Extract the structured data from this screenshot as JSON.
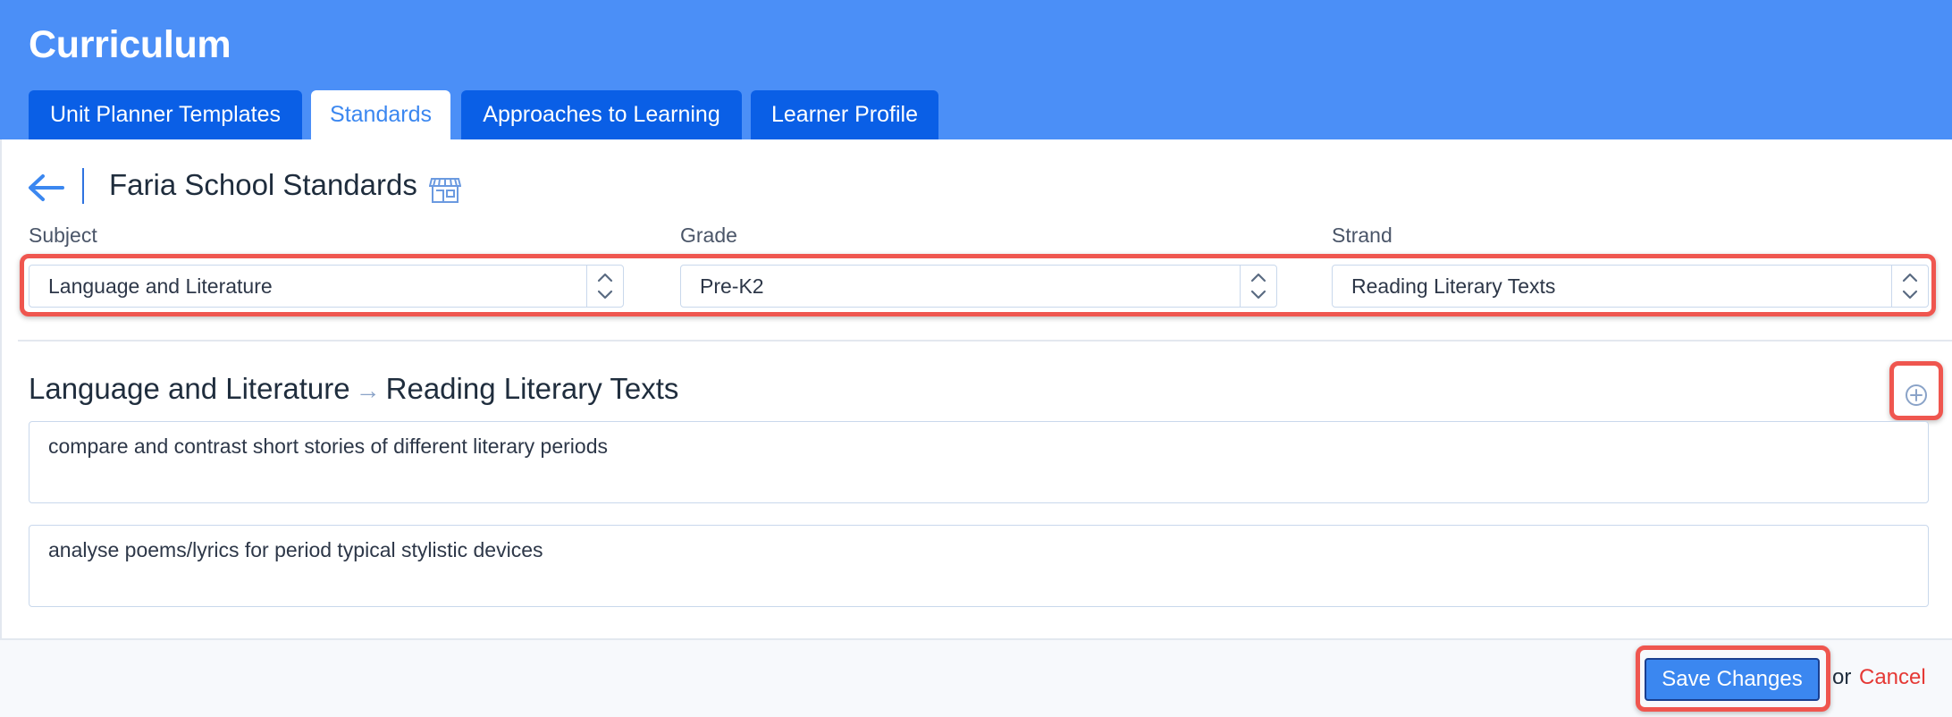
{
  "app": {
    "title": "Curriculum"
  },
  "tabs": [
    {
      "label": "Unit Planner Templates",
      "active": false
    },
    {
      "label": "Standards",
      "active": true
    },
    {
      "label": "Approaches to Learning",
      "active": false
    },
    {
      "label": "Learner Profile",
      "active": false
    }
  ],
  "doc": {
    "title": "Faria School Standards",
    "title_icon": "store-icon",
    "back_icon": "arrow-left-icon"
  },
  "filters": {
    "subject": {
      "label": "Subject",
      "value": "Language and Literature"
    },
    "grade": {
      "label": "Grade",
      "value": "Pre-K2"
    },
    "strand": {
      "label": "Strand",
      "value": "Reading Literary Texts"
    }
  },
  "section": {
    "subject": "Language and Literature",
    "arrow": "→",
    "strand": "Reading Literary Texts",
    "add_icon": "plus-circle-icon"
  },
  "standards": [
    {
      "text": "compare and contrast short stories of different literary periods"
    },
    {
      "text": "analyse poems/lyrics for period typical stylistic devices"
    }
  ],
  "footer": {
    "save_label": "Save Changes",
    "or_text": "or",
    "cancel_label": "Cancel"
  },
  "colors": {
    "header": "#4b8ff7",
    "tab": "#0a5fe6",
    "accent": "#3b87f0",
    "highlight": "#ef564f",
    "cancel": "#e53935"
  }
}
